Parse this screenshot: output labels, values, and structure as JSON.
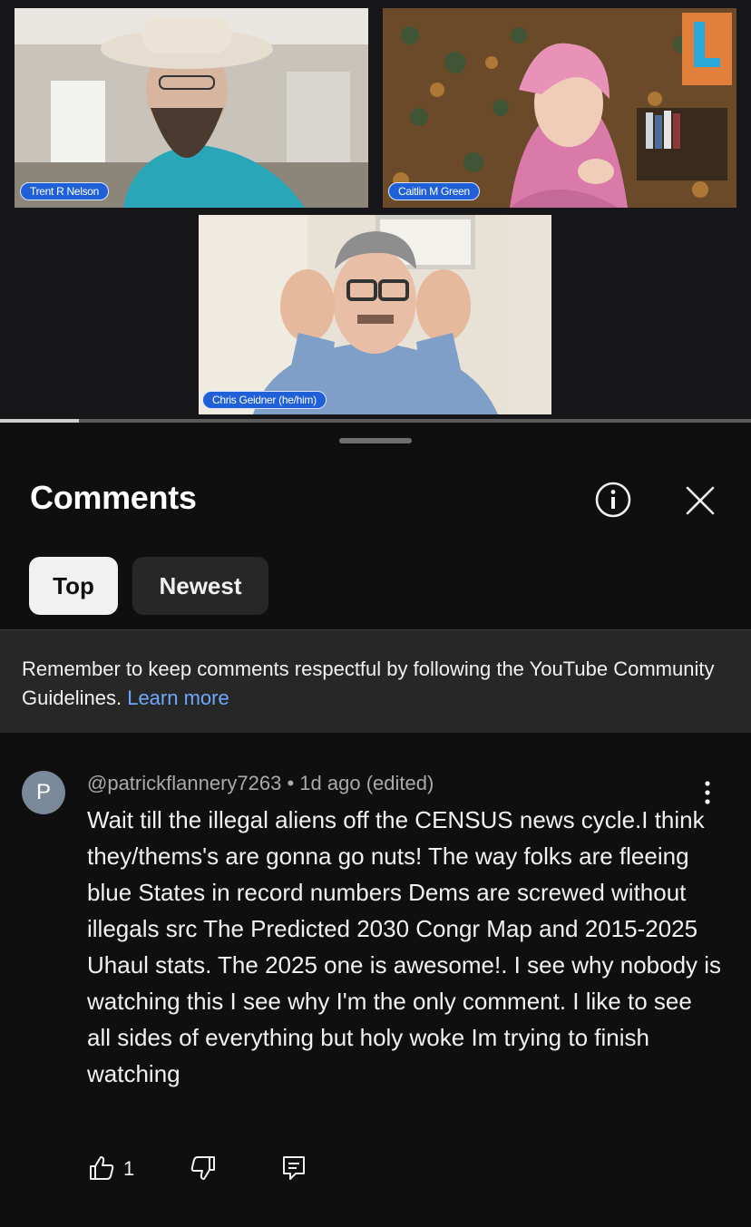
{
  "video": {
    "participants": [
      {
        "name": "Trent R Nelson"
      },
      {
        "name": "Caitlin M Green"
      },
      {
        "name": "Chris Geidner (he/him)"
      }
    ],
    "progress_fraction": 0.105
  },
  "comments_panel": {
    "title": "Comments",
    "info_icon": "info-icon",
    "close_icon": "close-icon",
    "sort_chips": [
      {
        "label": "Top",
        "selected": true
      },
      {
        "label": "Newest",
        "selected": false
      }
    ],
    "guidelines": {
      "text": "Remember to keep comments respectful by following the YouTube Community Guidelines.",
      "link": "Learn more"
    },
    "comments": [
      {
        "avatar_letter": "P",
        "author": "@patrickflannery7263",
        "separator": "•",
        "time": "1d ago (edited)",
        "text": "Wait till the illegal aliens off the CENSUS news cycle.I think they/thems's are gonna go nuts! The way folks are fleeing blue States in record numbers Dems are screwed without illegals  src The Predicted 2030 Congr Map and 2015-2025 Uhaul stats. The 2025 one is awesome!.  I see why nobody is watching this I see why I'm the only comment. I like to see all sides of everything but holy woke Im trying to finish watching",
        "likes": "1"
      }
    ]
  },
  "colors": {
    "background": "#0f0f0f",
    "chip_selected": "#f1f1f1",
    "chip_unselected": "#272727",
    "link": "#6ea8fe",
    "nametag": "#1f5fd8"
  }
}
